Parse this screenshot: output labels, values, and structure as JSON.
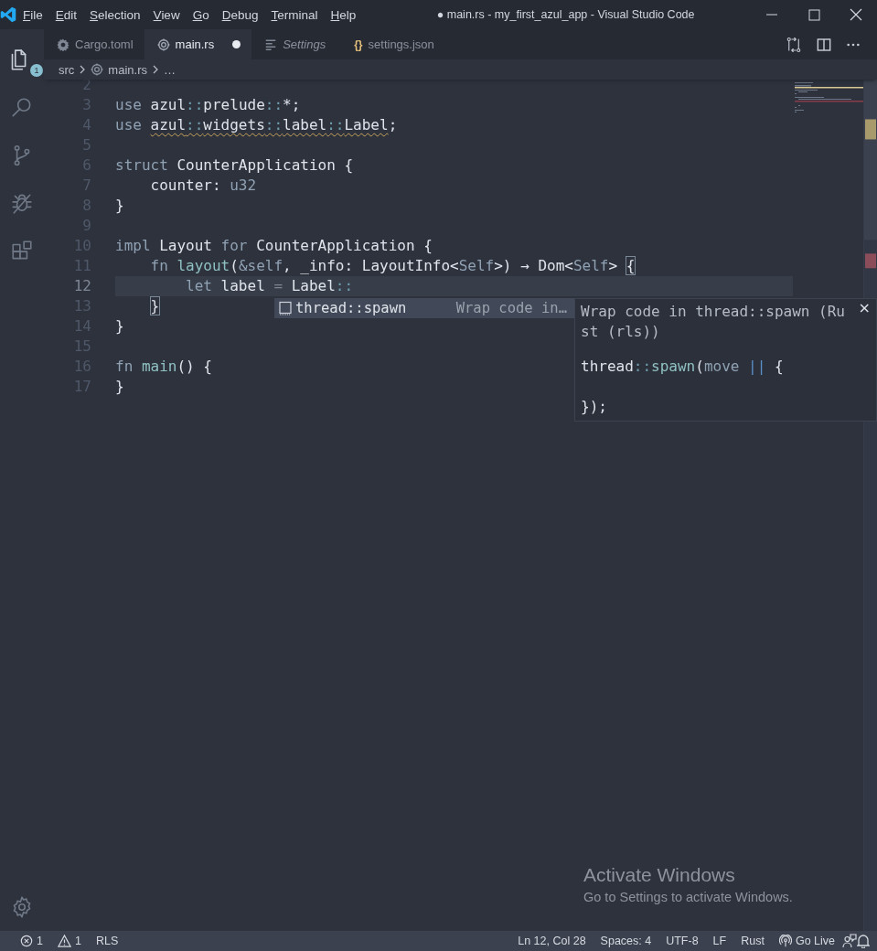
{
  "title_bar": {
    "menus": [
      "File",
      "Edit",
      "Selection",
      "View",
      "Go",
      "Debug",
      "Terminal",
      "Help"
    ],
    "title": "● main.rs - my_first_azul_app - Visual Studio Code"
  },
  "activity_bar": {
    "items": [
      {
        "kind": "explorer",
        "selected": true,
        "badge": "1"
      },
      {
        "kind": "search",
        "selected": false
      },
      {
        "kind": "scm",
        "selected": false
      },
      {
        "kind": "debug",
        "selected": false
      },
      {
        "kind": "extensions",
        "selected": false
      }
    ],
    "bottom": [
      {
        "kind": "settings",
        "selected": false
      }
    ]
  },
  "tabs": [
    {
      "label": "Cargo.toml",
      "kind": "config",
      "selected": false,
      "modified": false,
      "preview": false
    },
    {
      "label": "main.rs",
      "kind": "rust",
      "selected": true,
      "modified": true,
      "preview": false
    },
    {
      "label": "Settings",
      "kind": "settings",
      "selected": false,
      "modified": false,
      "preview": true
    },
    {
      "label": "settings.json",
      "kind": "json",
      "icon_text": "{}",
      "selected": false,
      "modified": false,
      "preview": false
    }
  ],
  "breadcrumbs": [
    {
      "label": "src",
      "kind": "folder"
    },
    {
      "label": "main.rs",
      "kind": "rust"
    },
    {
      "label": "…",
      "kind": "symbol"
    }
  ],
  "editor": {
    "lines": [
      {
        "number": "2",
        "current": false
      },
      {
        "number": "3",
        "current": false,
        "tokens": [
          {
            "text": "use",
            "kind": "kw"
          },
          {
            "text": " azul",
            "kind": "id"
          },
          {
            "text": "::",
            "kind": "punct"
          },
          {
            "text": "prelude",
            "kind": "id"
          },
          {
            "text": "::",
            "kind": "punct"
          },
          {
            "text": "*;",
            "kind": "id"
          }
        ]
      },
      {
        "number": "4",
        "current": false,
        "tokens": [
          {
            "text": "use ",
            "kind": "kw"
          },
          {
            "kind": "warning",
            "tokens": [
              {
                "text": "azul",
                "kind": "id"
              },
              {
                "text": "::",
                "kind": "punct"
              },
              {
                "text": "widgets",
                "kind": "id"
              },
              {
                "text": "::",
                "kind": "punct"
              },
              {
                "text": "label",
                "kind": "id"
              },
              {
                "text": "::",
                "kind": "punct"
              },
              {
                "text": "Label",
                "kind": "id"
              }
            ]
          },
          {
            "text": ";",
            "kind": "id"
          }
        ]
      },
      {
        "number": "5",
        "current": false
      },
      {
        "number": "6",
        "current": false,
        "tokens": [
          {
            "text": "struct",
            "kind": "kw"
          },
          {
            "text": " CounterApplication {",
            "kind": "id"
          }
        ]
      },
      {
        "number": "7",
        "current": false,
        "tokens": [
          {
            "text": "    counter: ",
            "kind": "id"
          },
          {
            "text": "u32",
            "kind": "kw"
          }
        ]
      },
      {
        "number": "8",
        "current": false,
        "tokens": [
          {
            "text": "}",
            "kind": "id"
          }
        ]
      },
      {
        "number": "9",
        "current": false
      },
      {
        "number": "10",
        "current": false,
        "tokens": [
          {
            "text": "impl",
            "kind": "kw"
          },
          {
            "text": " Layout ",
            "kind": "id"
          },
          {
            "text": "for",
            "kind": "kw"
          },
          {
            "text": " CounterApplication {",
            "kind": "id"
          }
        ]
      },
      {
        "number": "11",
        "current": false,
        "tokens": [
          {
            "text": "    fn ",
            "kind": "kw"
          },
          {
            "text": "layout",
            "kind": "fn"
          },
          {
            "text": "(",
            "kind": "id"
          },
          {
            "text": "&self",
            "kind": "kw"
          },
          {
            "text": ", _info: LayoutInfo<",
            "kind": "id"
          },
          {
            "text": "Self",
            "kind": "kw"
          },
          {
            "text": ">) → Dom<",
            "kind": "id"
          },
          {
            "text": "Self",
            "kind": "kw"
          },
          {
            "text": "> ",
            "kind": "id"
          },
          {
            "text": "{",
            "kind": "match"
          }
        ]
      },
      {
        "number": "12",
        "current": true,
        "tokens": [
          {
            "text": "        let",
            "kind": "kw"
          },
          {
            "text": " label ",
            "kind": "id"
          },
          {
            "text": "=",
            "kind": "op"
          },
          {
            "text": " Label",
            "kind": "id"
          },
          {
            "text": "::",
            "kind": "punct"
          }
        ]
      },
      {
        "number": "13",
        "current": false,
        "tokens": [
          {
            "text": "    }",
            "kind": "match"
          }
        ]
      },
      {
        "number": "14",
        "current": false,
        "tokens": [
          {
            "text": "}",
            "kind": "id"
          }
        ]
      },
      {
        "number": "15",
        "current": false
      },
      {
        "number": "16",
        "current": false,
        "tokens": [
          {
            "text": "fn ",
            "kind": "kw"
          },
          {
            "text": "main",
            "kind": "fn"
          },
          {
            "text": "() {",
            "kind": "id"
          }
        ]
      },
      {
        "number": "17",
        "current": false,
        "tokens": [
          {
            "text": "}",
            "kind": "id"
          }
        ]
      }
    ]
  },
  "suggestions": [
    {
      "label": "thread::spawn",
      "detail": "Wrap code in…",
      "selected": true
    }
  ],
  "suggestion_docs": {
    "title": "Wrap code in thread::spawn (Rust (rls))",
    "close": "×",
    "code": [
      {
        "tokens": [
          {
            "text": "thread",
            "kind": "id"
          },
          {
            "text": "::",
            "kind": "punct"
          },
          {
            "text": "spawn",
            "kind": "fn"
          },
          {
            "text": "(",
            "kind": "id"
          },
          {
            "text": "move",
            "kind": "kw"
          },
          {
            "text": " || ",
            "kind": "bar"
          },
          {
            "text": "{",
            "kind": "id"
          }
        ]
      },
      {
        "tokens": [
          {
            "text": "});",
            "kind": "id"
          }
        ]
      }
    ]
  },
  "windows_notice": {
    "title": "Activate Windows",
    "text": "Go to Settings to activate Windows."
  },
  "status_bar": {
    "left": [
      {
        "kind": "errors",
        "text": "1"
      },
      {
        "kind": "warnings",
        "text": "1"
      },
      {
        "kind": "text",
        "text": "RLS"
      }
    ],
    "right": [
      {
        "kind": "text",
        "text": "Ln 12, Col 28"
      },
      {
        "kind": "text",
        "text": "Spaces: 4"
      },
      {
        "kind": "text",
        "text": "UTF-8"
      },
      {
        "kind": "text",
        "text": "LF"
      },
      {
        "kind": "text",
        "text": "Rust"
      },
      {
        "kind": "live",
        "text": "Go Live"
      },
      {
        "kind": "feedback"
      },
      {
        "kind": "bell"
      }
    ]
  }
}
